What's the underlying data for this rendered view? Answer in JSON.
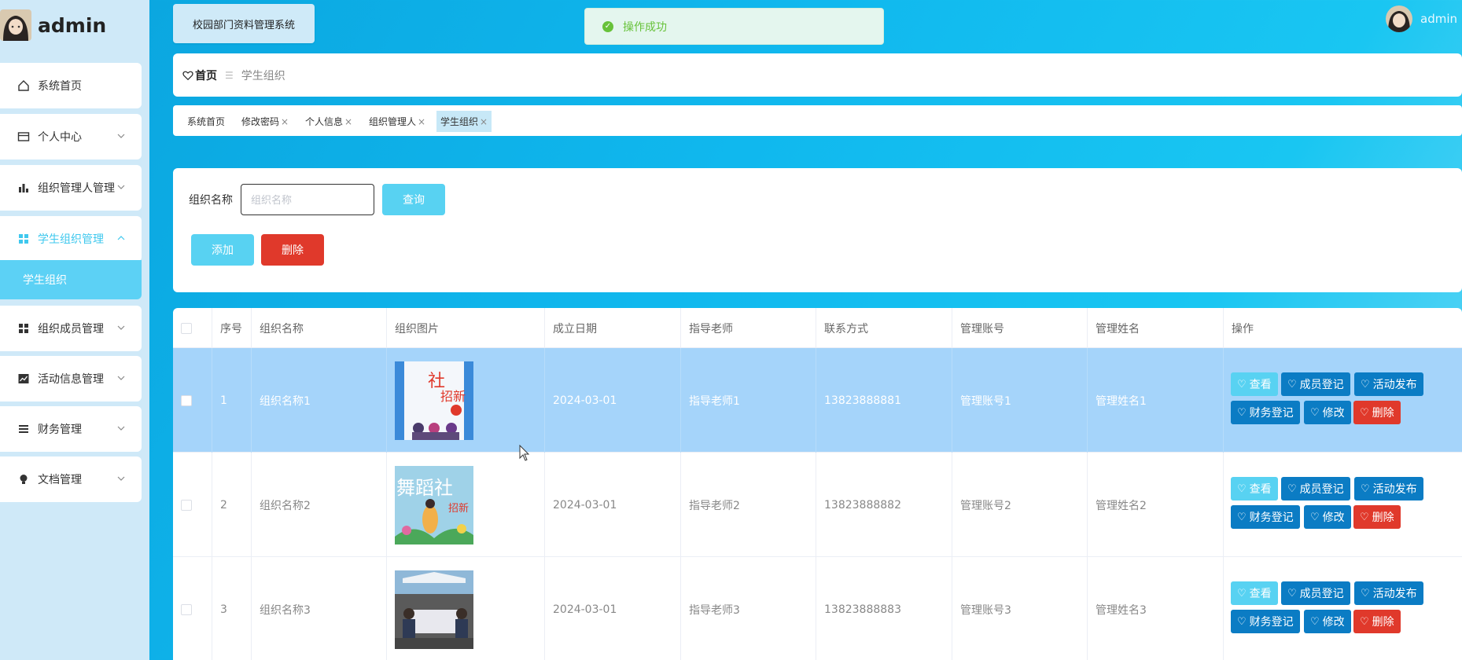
{
  "app": {
    "brand": "admin",
    "system_title": "校园部门资料管理系统",
    "toast": "操作成功",
    "user": "admin"
  },
  "sidebar": {
    "items": [
      {
        "label": "系统首页",
        "icon": "home-icon"
      },
      {
        "label": "个人中心",
        "icon": "card-icon"
      },
      {
        "label": "组织管理人管理",
        "icon": "bar-chart-icon"
      },
      {
        "label": "学生组织管理",
        "icon": "grid-icon"
      },
      {
        "label": "组织成员管理",
        "icon": "grid-icon"
      },
      {
        "label": "活动信息管理",
        "icon": "line-chart-icon"
      },
      {
        "label": "财务管理",
        "icon": "list-icon"
      },
      {
        "label": "文档管理",
        "icon": "bulb-icon"
      }
    ],
    "sub_active": "学生组织"
  },
  "breadcrumb": {
    "home": "首页",
    "current": "学生组织"
  },
  "tabs": [
    {
      "label": "系统首页"
    },
    {
      "label": "修改密码"
    },
    {
      "label": "个人信息"
    },
    {
      "label": "组织管理人"
    },
    {
      "label": "学生组织"
    }
  ],
  "search": {
    "label": "组织名称",
    "placeholder": "组织名称",
    "query_label": "查询",
    "add_label": "添加",
    "delete_label": "删除"
  },
  "table": {
    "headers": [
      "序号",
      "组织名称",
      "组织图片",
      "成立日期",
      "指导老师",
      "联系方式",
      "管理账号",
      "管理姓名",
      "操作"
    ],
    "rows": [
      {
        "no": "1",
        "name": "组织名称1",
        "date": "2024-03-01",
        "teacher": "指导老师1",
        "phone": "13823888881",
        "account": "管理账号1",
        "manager": "管理姓名1"
      },
      {
        "no": "2",
        "name": "组织名称2",
        "date": "2024-03-01",
        "teacher": "指导老师2",
        "phone": "13823888882",
        "account": "管理账号2",
        "manager": "管理姓名2"
      },
      {
        "no": "3",
        "name": "组织名称3",
        "date": "2024-03-01",
        "teacher": "指导老师3",
        "phone": "13823888883",
        "account": "管理账号3",
        "manager": "管理姓名3"
      }
    ],
    "actions": {
      "view": "查看",
      "member": "成员登记",
      "activity": "活动发布",
      "finance": "财务登记",
      "edit": "修改",
      "delete": "删除"
    }
  },
  "colors": {
    "accent": "#58d2f2",
    "primary": "#0b7cc4",
    "danger": "#e0392b",
    "selected_row": "#a5d4fa"
  }
}
